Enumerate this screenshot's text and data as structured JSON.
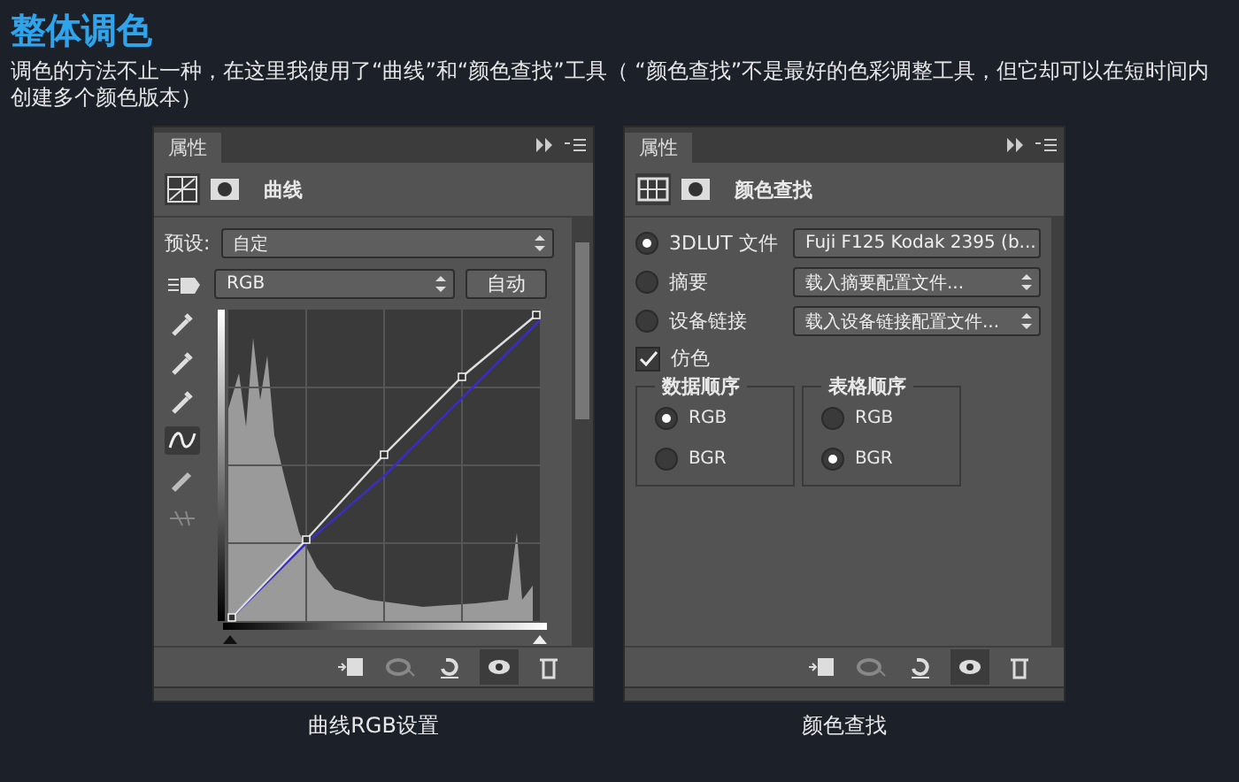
{
  "heading": "整体调色",
  "intro": "调色的方法不止一种，在这里我使用了“曲线”和“颜色查找”工具（ “颜色查找”不是最好的色彩调整工具，但它却可以在短时间内创建多个颜色版本）",
  "panels": [
    {
      "kind": "curves",
      "tab": "属性",
      "title": "曲线",
      "preset_label": "预设:",
      "preset_value": "自定",
      "channel": "RGB",
      "auto_button": "自动",
      "input_sliders": [
        {
          "level": 0
        },
        {
          "level": 1
        }
      ],
      "tools": [
        {
          "kind": "eyedropper",
          "selected": false
        },
        {
          "kind": "eyedropper",
          "selected": false
        },
        {
          "kind": "eyedropper",
          "selected": false
        },
        {
          "kind": "curve",
          "selected": true
        },
        {
          "kind": "pencil",
          "selected": false
        },
        {
          "kind": "smooth",
          "selected": false
        }
      ],
      "caption": "曲线RGB设置"
    },
    {
      "kind": "lookup",
      "tab": "属性",
      "title": "颜色查找",
      "sources": [
        {
          "label": "3DLUT 文件",
          "value": "Fuji F125 Kodak 2395 (b...",
          "selected": true
        },
        {
          "label": "摘要",
          "value": "载入摘要配置文件...",
          "selected": false
        },
        {
          "label": "设备链接",
          "value": "载入设备链接配置文件...",
          "selected": false
        }
      ],
      "dither": {
        "label": "仿色",
        "checked": true
      },
      "groups": [
        {
          "title": "数据顺序",
          "options": [
            {
              "label": "RGB",
              "selected": true
            },
            {
              "label": "BGR",
              "selected": false
            }
          ]
        },
        {
          "title": "表格顺序",
          "options": [
            {
              "label": "RGB",
              "selected": false
            },
            {
              "label": "BGR",
              "selected": true
            }
          ]
        }
      ],
      "caption": "颜色查找"
    }
  ]
}
